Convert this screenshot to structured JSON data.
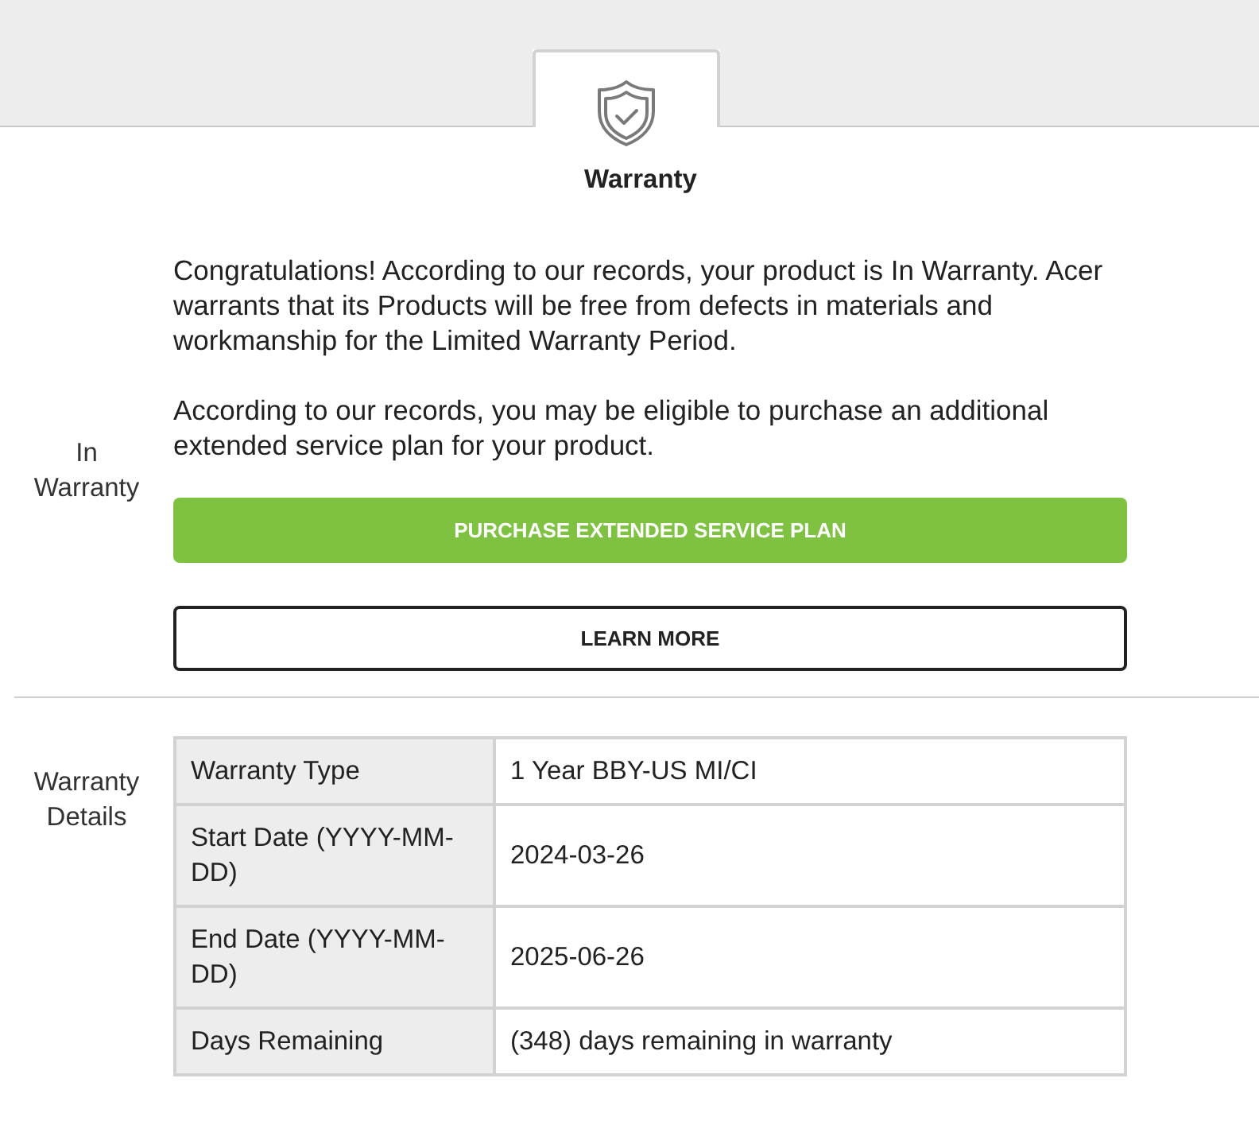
{
  "tab": {
    "label": "Warranty",
    "selected": true
  },
  "sections": [
    {
      "kind": "message",
      "label": "In Warranty",
      "paragraphs": [
        "Congratulations! According to our records, your product is In Warranty. Acer warrants that its Products will be free from defects in materials and workmanship for the Limited Warranty Period.",
        "According to our records, you may be eligible to purchase an additional extended service plan for your product."
      ],
      "buttons": [
        {
          "kind": "primary",
          "label": "PURCHASE EXTENDED SERVICE PLAN"
        },
        {
          "kind": "outline",
          "label": "LEARN MORE"
        }
      ]
    },
    {
      "kind": "table",
      "label": "Warranty Details",
      "rows": [
        {
          "label": "Warranty Type",
          "value": "1 Year BBY-US MI/CI"
        },
        {
          "label": "Start Date (YYYY-MM-DD)",
          "value": "2024-03-26"
        },
        {
          "label": "End Date (YYYY-MM-DD)",
          "value": "2025-06-26"
        },
        {
          "label": "Days Remaining",
          "value": "(348) days remaining in warranty"
        }
      ]
    }
  ]
}
